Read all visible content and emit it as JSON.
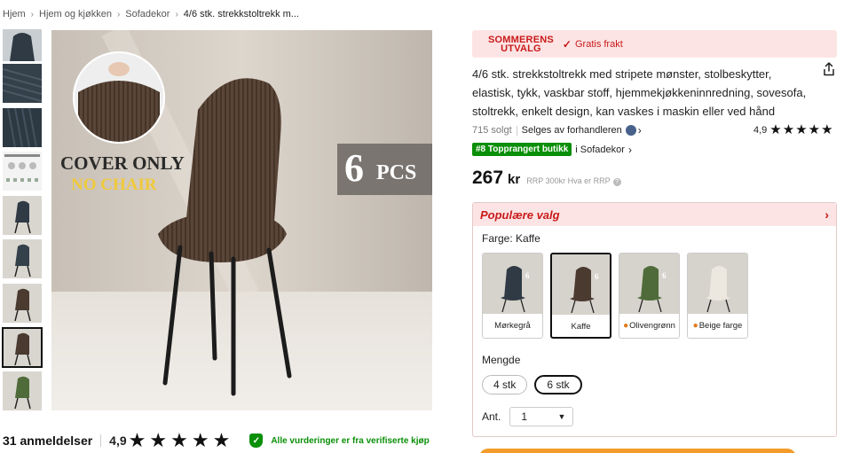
{
  "breadcrumb": [
    "Hjem",
    "Hjem og kjøkken",
    "Sofadekor",
    "4/6 stk. strekkstoltrekk m..."
  ],
  "main_image": {
    "overlay_line1": "COVER ONLY",
    "overlay_line2": "NO CHAIR",
    "badge_num": "6",
    "badge_text": "PCS"
  },
  "reviews": {
    "count_label": "31 anmeldelser",
    "rating": "4,9",
    "stars": 5,
    "verified_text": "Alle vurderinger er fra verifiserte kjøp"
  },
  "promo": {
    "brand_line1": "SOMMERENS",
    "brand_line2": "UTVALG",
    "free_shipping": "Gratis frakt"
  },
  "product": {
    "title": "4/6 stk. strekkstoltrekk med stripete mønster, stolbeskytter, elastisk, tykk, vaskbar stoff, hjemmekjøkkeninnredning, sovesofa, stoltrekk, enkelt design, kan vaskes i maskin eller ved hånd",
    "sold": "715 solgt",
    "seller": "Selges av forhandleren",
    "rating": "4,9",
    "store_badge": "#8 Topprangert butikk",
    "store_name": "i Sofadekor",
    "price": "267",
    "currency": "kr",
    "rrp": "RRP 300kr Hva er RRP"
  },
  "options": {
    "panel_title": "Populære valg",
    "color_label": "Farge: Kaffe",
    "colors": [
      {
        "label": "Mørkegrå",
        "hex": "#2f3a44",
        "hot": false
      },
      {
        "label": "Kaffe",
        "hex": "#4a3a30",
        "hot": false,
        "selected": true
      },
      {
        "label": "Olivengrønn",
        "hex": "#4f6b3a",
        "hot": true
      },
      {
        "label": "Beige farge",
        "hex": "#d8d2c4",
        "hot": true
      }
    ],
    "qty_label": "Mengde",
    "quantities": [
      "4 stk",
      "6 stk"
    ],
    "selected_quantity": "6 stk",
    "ant_label": "Ant.",
    "ant_value": "1"
  },
  "colors": {
    "accent_red": "#c81a1a",
    "promo_bg": "#fde4e4",
    "verified_green": "#0a8f08",
    "cart_orange": "#f39c2b"
  }
}
